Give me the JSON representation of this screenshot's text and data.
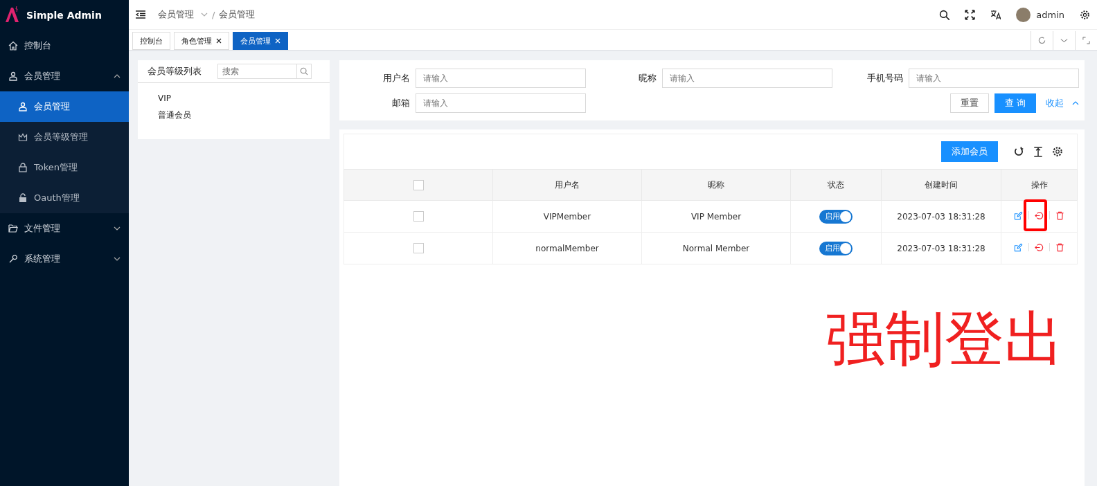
{
  "brand": "Simple Admin",
  "sidebar": {
    "items": [
      {
        "label": "控制台",
        "selected": false
      },
      {
        "label": "会员管理",
        "expanded": true,
        "selected": false,
        "children": [
          {
            "label": "会员管理",
            "selected": true
          },
          {
            "label": "会员等级管理",
            "selected": false
          },
          {
            "label": "Token管理",
            "selected": false
          },
          {
            "label": "Oauth管理",
            "selected": false
          }
        ]
      },
      {
        "label": "文件管理",
        "expanded": false,
        "selected": false
      },
      {
        "label": "系统管理",
        "expanded": false,
        "selected": false
      }
    ]
  },
  "breadcrumb": [
    "会员管理",
    "/",
    "会员管理"
  ],
  "user": "admin",
  "tabs": [
    {
      "label": "控制台",
      "closable": false,
      "selected": false
    },
    {
      "label": "角色管理",
      "closable": true,
      "selected": false
    },
    {
      "label": "会员管理",
      "closable": true,
      "selected": true
    }
  ],
  "level_panel": {
    "title": "会员等级列表",
    "search_placeholder": "搜索",
    "items": [
      "VIP",
      "普通会员"
    ]
  },
  "filters": [
    {
      "label": "用户名",
      "placeholder": "请输入"
    },
    {
      "label": "昵称",
      "placeholder": "请输入"
    },
    {
      "label": "手机号码",
      "placeholder": "请输入"
    },
    {
      "label": "邮箱",
      "placeholder": "请输入"
    }
  ],
  "filter_buttons": {
    "reset": "重置",
    "query": "查 询",
    "collapse": "收起"
  },
  "table": {
    "add_button": "添加会员",
    "header_checked": false,
    "columns": [
      "用户名",
      "昵称",
      "状态",
      "创建时间",
      "操作"
    ],
    "rows": [
      {
        "checked": false,
        "username": "VIPMember",
        "nickname": "VIP Member",
        "status": "启用",
        "on": true,
        "created": "2023-07-03 18:31:28"
      },
      {
        "checked": false,
        "username": "normalMember",
        "nickname": "Normal Member",
        "status": "启用",
        "on": true,
        "created": "2023-07-03 18:31:28"
      }
    ]
  },
  "annotation": "强制登出"
}
